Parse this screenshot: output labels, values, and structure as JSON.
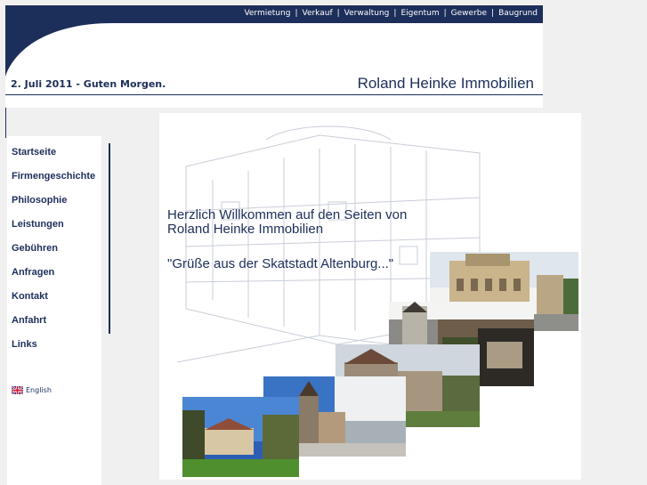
{
  "header": {
    "topnav": [
      "Vermietung",
      "Verkauf",
      "Verwaltung",
      "Eigentum",
      "Gewerbe",
      "Baugrund"
    ],
    "greeting": "2. Juli 2011 - Guten Morgen.",
    "brand": "Roland Heinke Immobilien"
  },
  "sidebar": {
    "items": [
      "Startseite",
      "Firmengeschichte",
      "Philosophie",
      "Leistungen",
      "Gebühren",
      "Anfragen",
      "Kontakt",
      "Anfahrt",
      "Links"
    ],
    "language_link": "English"
  },
  "content": {
    "welcome_line1": "Herzlich Willkommen auf den Seiten von",
    "welcome_line2": "Roland Heinke Immobilien",
    "motto": "\"Grüße aus der Skatstadt Altenburg...\""
  },
  "colors": {
    "brand_navy": "#1c2e5a",
    "page_background": "#f0f0f0"
  }
}
